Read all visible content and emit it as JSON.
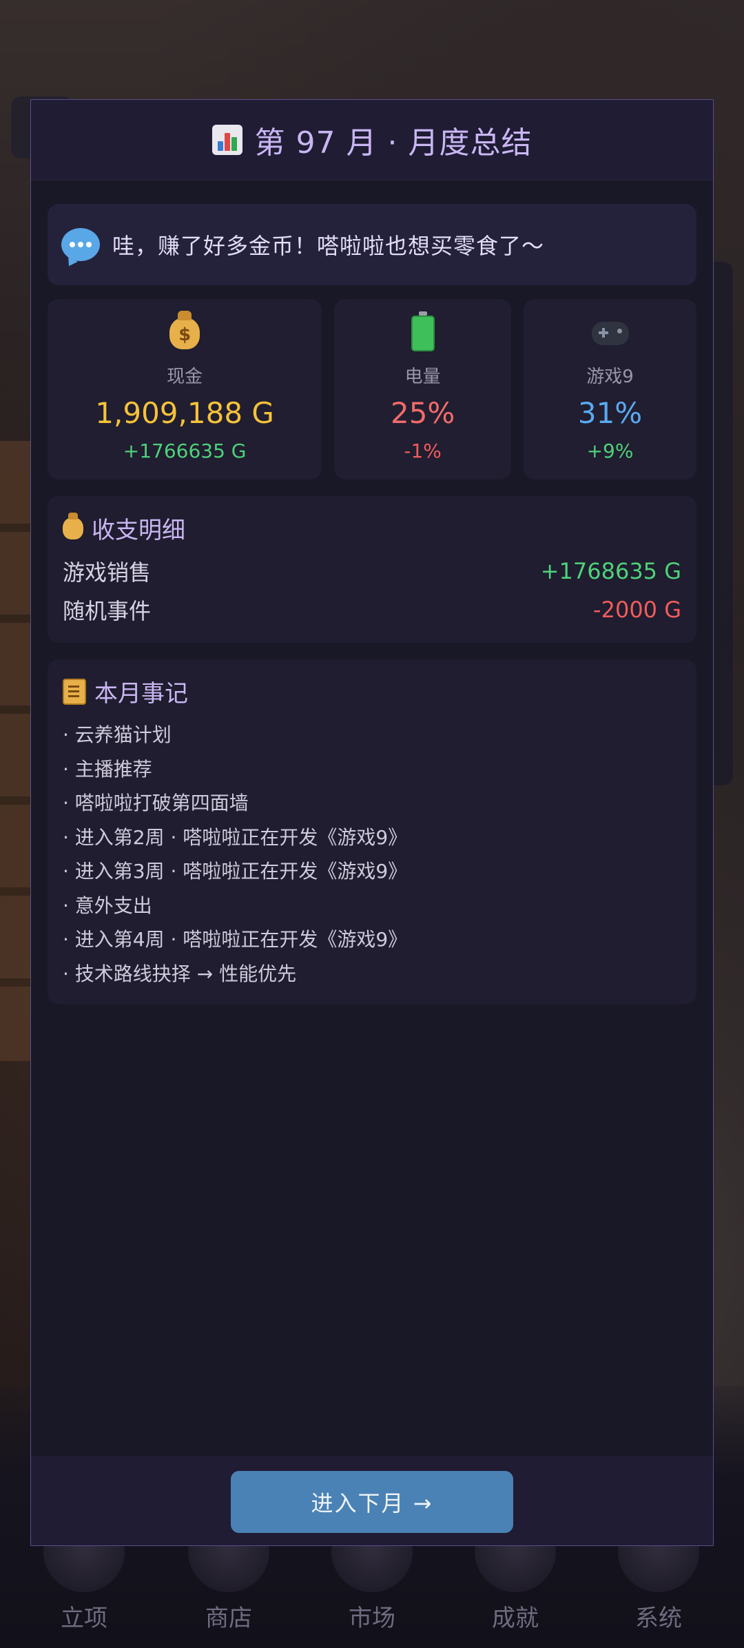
{
  "modal": {
    "title": "第 97 月 · 月度总结",
    "message": "哇，赚了好多金币！嗒啦啦也想买零食了～",
    "stats": {
      "cash": {
        "label": "现金",
        "value": "1,909,188 G",
        "delta": "+1766635 G",
        "icon": "money-bag-icon",
        "value_color": "#f5c23a"
      },
      "power": {
        "label": "电量",
        "value": "25%",
        "delta": "-1%",
        "icon": "battery-icon",
        "value_color": "#f26b6b"
      },
      "game": {
        "label": "游戏9",
        "value": "31%",
        "delta": "+9%",
        "icon": "gamepad-icon",
        "value_color": "#5aa9f0"
      }
    },
    "finance": {
      "title": "收支明细",
      "rows": [
        {
          "label": "游戏销售",
          "amount": "+1768635 G"
        },
        {
          "label": "随机事件",
          "amount": "-2000 G"
        }
      ]
    },
    "events": {
      "title": "本月事记",
      "items": [
        "· 云养猫计划",
        "· 主播推荐",
        "· 嗒啦啦打破第四面墙",
        "· 进入第2周 · 嗒啦啦正在开发《游戏9》",
        "· 进入第3周 · 嗒啦啦正在开发《游戏9》",
        "· 意外支出",
        "· 进入第4周 · 嗒啦啦正在开发《游戏9》",
        "· 技术路线抉择 → 性能优先"
      ]
    },
    "next_button": "进入下月 →"
  },
  "tabbar": {
    "items": [
      "立项",
      "商店",
      "市场",
      "成就",
      "系统"
    ]
  },
  "colors": {
    "accent": "#c9b6f2",
    "positive": "#4fd17a",
    "negative": "#f25c5c",
    "button": "#4a82b5"
  }
}
